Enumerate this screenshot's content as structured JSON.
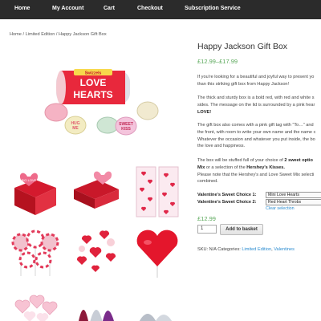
{
  "nav": {
    "items": [
      "Home",
      "My Account",
      "Cart",
      "Checkout",
      "Subscription Service"
    ]
  },
  "breadcrumb": {
    "home": "Home",
    "sep1": "/",
    "category": "Limited Edition",
    "sep2": "/",
    "current": "Happy Jackson Gift Box"
  },
  "gallery": {
    "main_image_text": {
      "brand": "Swizzels",
      "tube_line1": "LOVE",
      "tube_line2": "HEARTS",
      "sweet1_line1": "HUG",
      "sweet1_line2": "ME",
      "sweet2_line1": "SWEET",
      "sweet2_line2": "KISS",
      "thumb1_text": "BIG LOVE"
    }
  },
  "product": {
    "title": "Happy Jackson Gift Box",
    "price_range": "£12.99–£17.99",
    "para1_line1": "If you're looking for a beautiful and joyful way to present yo",
    "para1_line2": "than this striking gift box from Happy Jackson!",
    "para2_line1": "The thick and sturdy box is a bold red, with red and white s",
    "para2_line2": "sides. The message on the lid is surrounded by a pink hear",
    "para2_line3": "LOVE!",
    "para3_line1": "The gift box also comes with a pink gift tag with “To…” and",
    "para3_line2": "the front, with room to write your own name and the name c",
    "para3_line3": "Whatever the occasion and whatever you put inside, the bo",
    "para3_line4": "the love and happiness.",
    "para4_line1_pre": "The box will be stuffed full of your choice of ",
    "para4_line1_bold": "2 sweet optio",
    "para4_line2_bold1": "Mix",
    "para4_line2_mid": " or a selection of the ",
    "para4_line2_bold2": "Hershey's Kisses.",
    "para4_line3": "Please note that the Hershey's and Love Sweet Mix selecti",
    "para4_line4": "combined."
  },
  "options": {
    "choice1_label": "Valentine's Sweet Choice 1:",
    "choice1_value": "Mini Love Hearts",
    "choice2_label": "Valentine's Sweet Choice 2:",
    "choice2_value": "Red Heart Throbs",
    "clear_label": "Clear selection"
  },
  "purchase": {
    "price": "£12.99",
    "quantity": "1",
    "add_label": "Add to basket"
  },
  "meta": {
    "sku_label": "SKU: N/A",
    "categories_label": "Categories:",
    "category1": "Limited Edition",
    "separator": ",",
    "category2": "Valentines"
  },
  "colors": {
    "nav_bg": "#2b2b2b",
    "price_green": "#5aa85a",
    "link_blue": "#2a8bd0",
    "gift_red": "#d41a2e"
  }
}
